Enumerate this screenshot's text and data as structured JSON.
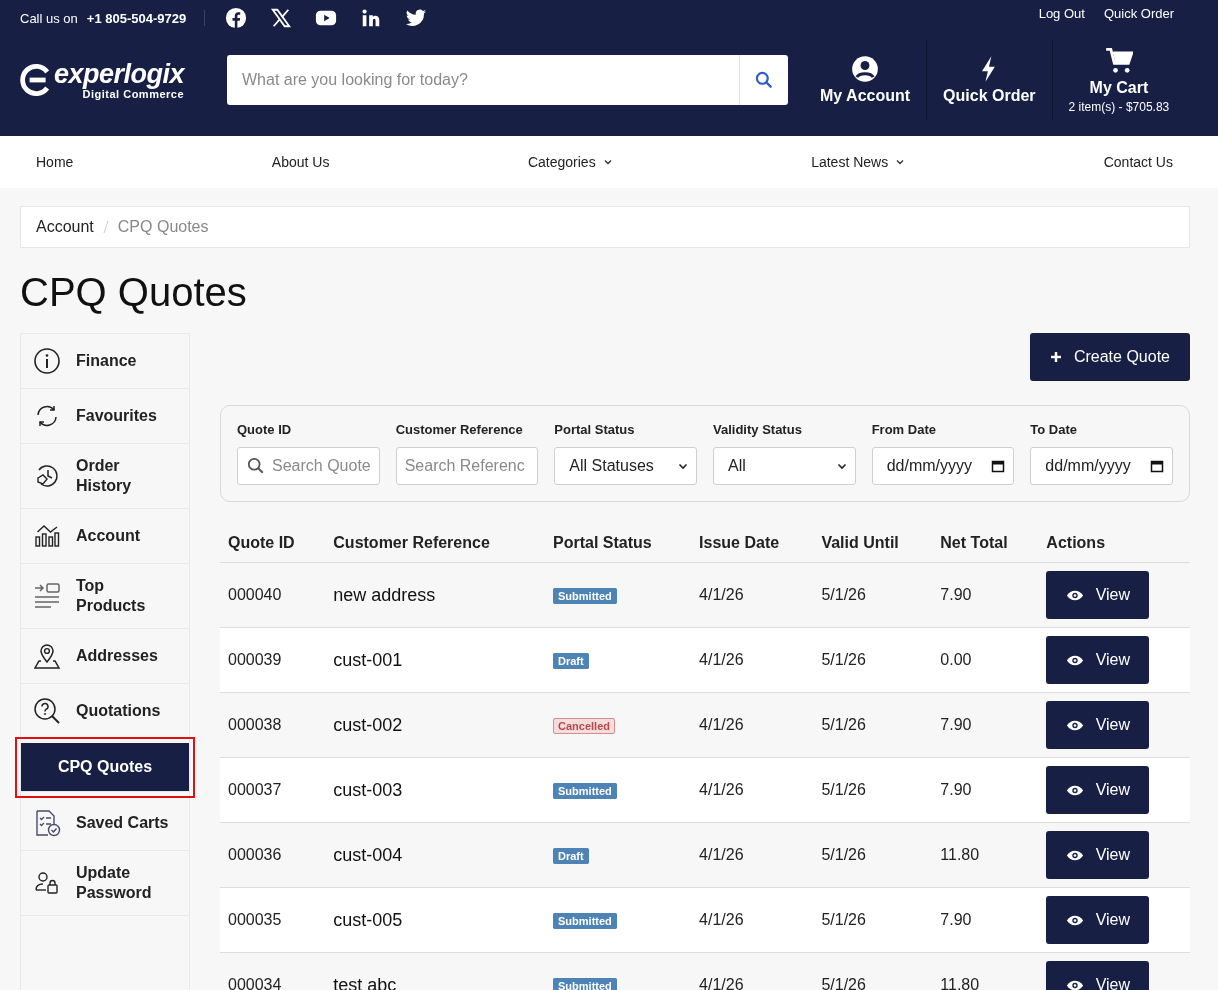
{
  "top_bar": {
    "call_label": "Call us on",
    "phone": "+1 805-504-9729",
    "links": [
      "Log Out",
      "Quick Order"
    ]
  },
  "header": {
    "logo_text": "experlogix",
    "logo_sub": "Digital Commerce",
    "search": {
      "placeholder": "What are you looking for today?"
    },
    "actions": [
      {
        "kind": "account",
        "label": "My Account"
      },
      {
        "kind": "quick",
        "label": "Quick Order"
      },
      {
        "kind": "cart",
        "label": "My Cart",
        "sub": "2 item(s) - $705.83"
      }
    ]
  },
  "nav": [
    {
      "label": "Home",
      "dropdown": false
    },
    {
      "label": "About Us",
      "dropdown": false
    },
    {
      "label": "Categories",
      "dropdown": true
    },
    {
      "label": "Latest News",
      "dropdown": true
    },
    {
      "label": "Contact Us",
      "dropdown": false
    }
  ],
  "breadcrumb": [
    "Account",
    "CPQ Quotes"
  ],
  "page_title": "CPQ Quotes",
  "sidebar": {
    "items": [
      {
        "label": "Finance",
        "selected": false
      },
      {
        "label": "Favourites",
        "selected": false
      },
      {
        "label": "Order History",
        "selected": false
      },
      {
        "label": "Account",
        "selected": false
      },
      {
        "label": "Top Products",
        "selected": false
      },
      {
        "label": "Addresses",
        "selected": false
      },
      {
        "label": "Quotations",
        "selected": false
      },
      {
        "label": "CPQ Quotes",
        "selected": true
      },
      {
        "label": "Saved Carts",
        "selected": false
      },
      {
        "label": "Update Password",
        "selected": false
      }
    ]
  },
  "create_button": "Create Quote",
  "filters": [
    {
      "kind": "search",
      "label": "Quote ID",
      "placeholder": "Search Quote"
    },
    {
      "kind": "text",
      "label": "Customer Reference",
      "placeholder": "Search Referenc"
    },
    {
      "kind": "select",
      "label": "Portal Status",
      "value": "All Statuses"
    },
    {
      "kind": "select",
      "label": "Validity Status",
      "value": "All"
    },
    {
      "kind": "date",
      "label": "From Date",
      "placeholder": "dd/mm/yyyy"
    },
    {
      "kind": "date",
      "label": "To Date",
      "placeholder": "dd/mm/yyyy"
    }
  ],
  "table": {
    "columns": [
      "Quote ID",
      "Customer Reference",
      "Portal Status",
      "Issue Date",
      "Valid Until",
      "Net Total",
      "Actions"
    ],
    "rows": [
      {
        "id": "000040",
        "reference": "new address",
        "status": {
          "label": "Submitted",
          "color": "#4e84b5"
        },
        "issue": "4/1/26",
        "valid": "5/1/26",
        "total": "7.90",
        "action": "View"
      },
      {
        "id": "000039",
        "reference": "cust-001",
        "status": {
          "label": "Draft",
          "color": "#4e84b5"
        },
        "issue": "4/1/26",
        "valid": "5/1/26",
        "total": "0.00",
        "action": "View"
      },
      {
        "id": "000038",
        "reference": "cust-002",
        "status": {
          "label": "Cancelled",
          "color": "#f6dcdc"
        },
        "issue": "4/1/26",
        "valid": "5/1/26",
        "total": "7.90",
        "action": "View"
      },
      {
        "id": "000037",
        "reference": "cust-003",
        "status": {
          "label": "Submitted",
          "color": "#4e84b5"
        },
        "issue": "4/1/26",
        "valid": "5/1/26",
        "total": "7.90",
        "action": "View"
      },
      {
        "id": "000036",
        "reference": "cust-004",
        "status": {
          "label": "Draft",
          "color": "#4e84b5"
        },
        "issue": "4/1/26",
        "valid": "5/1/26",
        "total": "11.80",
        "action": "View"
      },
      {
        "id": "000035",
        "reference": "cust-005",
        "status": {
          "label": "Submitted",
          "color": "#4e84b5"
        },
        "issue": "4/1/26",
        "valid": "5/1/26",
        "total": "7.90",
        "action": "View"
      },
      {
        "id": "000034",
        "reference": "test abc",
        "status": {
          "label": "Submitted",
          "color": "#4e84b5"
        },
        "issue": "4/1/26",
        "valid": "5/1/26",
        "total": "11.80",
        "action": "View"
      }
    ]
  }
}
